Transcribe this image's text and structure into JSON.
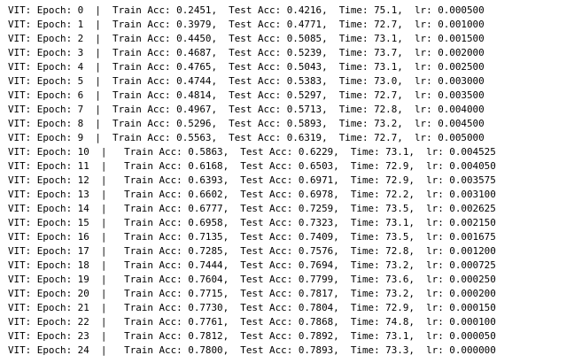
{
  "log": {
    "lines": [
      "VIT: Epoch: 0  |  Train Acc: 0.2451,  Test Acc: 0.4216,  Time: 75.1,  lr: 0.000500",
      "VIT: Epoch: 1  |  Train Acc: 0.3979,  Test Acc: 0.4771,  Time: 72.7,  lr: 0.001000",
      "VIT: Epoch: 2  |  Train Acc: 0.4450,  Test Acc: 0.5085,  Time: 73.1,  lr: 0.001500",
      "VIT: Epoch: 3  |  Train Acc: 0.4687,  Test Acc: 0.5239,  Time: 73.7,  lr: 0.002000",
      "VIT: Epoch: 4  |  Train Acc: 0.4765,  Test Acc: 0.5043,  Time: 73.1,  lr: 0.002500",
      "VIT: Epoch: 5  |  Train Acc: 0.4744,  Test Acc: 0.5383,  Time: 73.0,  lr: 0.003000",
      "VIT: Epoch: 6  |  Train Acc: 0.4814,  Test Acc: 0.5297,  Time: 72.7,  lr: 0.003500",
      "VIT: Epoch: 7  |  Train Acc: 0.4967,  Test Acc: 0.5713,  Time: 72.8,  lr: 0.004000",
      "VIT: Epoch: 8  |  Train Acc: 0.5296,  Test Acc: 0.5893,  Time: 73.2,  lr: 0.004500",
      "VIT: Epoch: 9  |  Train Acc: 0.5563,  Test Acc: 0.6319,  Time: 72.7,  lr: 0.005000",
      "VIT: Epoch: 10  |   Train Acc: 0.5863,  Test Acc: 0.6229,  Time: 73.1,  lr: 0.004525",
      "VIT: Epoch: 11  |   Train Acc: 0.6168,  Test Acc: 0.6503,  Time: 72.9,  lr: 0.004050",
      "VIT: Epoch: 12  |   Train Acc: 0.6393,  Test Acc: 0.6971,  Time: 72.9,  lr: 0.003575",
      "VIT: Epoch: 13  |   Train Acc: 0.6602,  Test Acc: 0.6978,  Time: 72.2,  lr: 0.003100",
      "VIT: Epoch: 14  |   Train Acc: 0.6777,  Test Acc: 0.7259,  Time: 73.5,  lr: 0.002625",
      "VIT: Epoch: 15  |   Train Acc: 0.6958,  Test Acc: 0.7323,  Time: 73.1,  lr: 0.002150",
      "VIT: Epoch: 16  |   Train Acc: 0.7135,  Test Acc: 0.7409,  Time: 73.5,  lr: 0.001675",
      "VIT: Epoch: 17  |   Train Acc: 0.7285,  Test Acc: 0.7576,  Time: 72.8,  lr: 0.001200",
      "VIT: Epoch: 18  |   Train Acc: 0.7444,  Test Acc: 0.7694,  Time: 73.2,  lr: 0.000725",
      "VIT: Epoch: 19  |   Train Acc: 0.7604,  Test Acc: 0.7799,  Time: 73.6,  lr: 0.000250",
      "VIT: Epoch: 20  |   Train Acc: 0.7715,  Test Acc: 0.7817,  Time: 73.2,  lr: 0.000200",
      "VIT: Epoch: 21  |   Train Acc: 0.7730,  Test Acc: 0.7804,  Time: 72.9,  lr: 0.000150",
      "VIT: Epoch: 22  |   Train Acc: 0.7761,  Test Acc: 0.7868,  Time: 74.8,  lr: 0.000100",
      "VIT: Epoch: 23  |   Train Acc: 0.7812,  Test Acc: 0.7892,  Time: 73.1,  lr: 0.000050",
      "VIT: Epoch: 24  |   Train Acc: 0.7800,  Test Acc: 0.7893,  Time: 73.3,  lr: 0.000000"
    ]
  }
}
